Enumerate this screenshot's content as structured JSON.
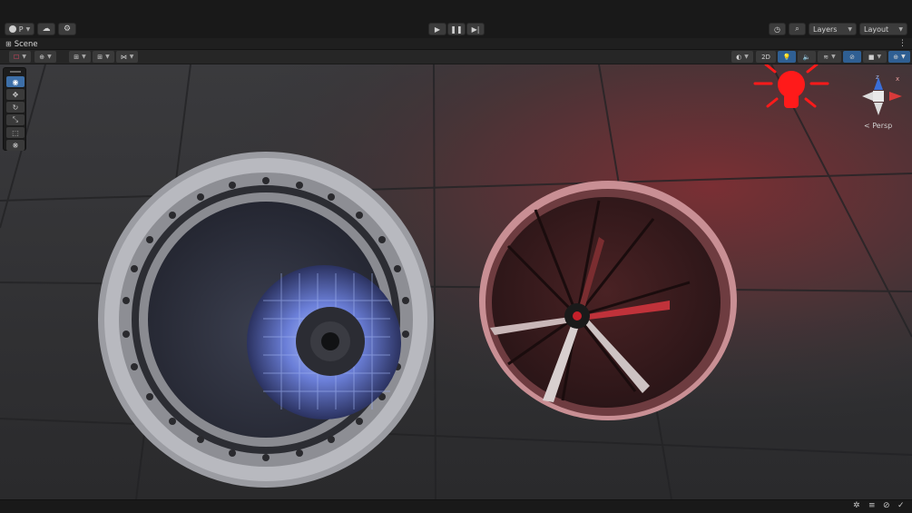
{
  "toolbar": {
    "account_label": "P",
    "layers_label": "Layers",
    "layout_label": "Layout"
  },
  "scene_tab": {
    "title": "Scene"
  },
  "scene_toolbar": {
    "mode_2d_label": "2D"
  },
  "gizmo": {
    "projection_label": "< Persp",
    "axis_z": "z",
    "axis_x": "x"
  },
  "tools": [
    "view-tool",
    "move-tool",
    "rotate-tool",
    "scale-tool",
    "rect-tool",
    "transform-tool"
  ],
  "colors": {
    "accent": "#3d6fa8",
    "light_icon": "#ff1a1a",
    "background": "#191919"
  }
}
